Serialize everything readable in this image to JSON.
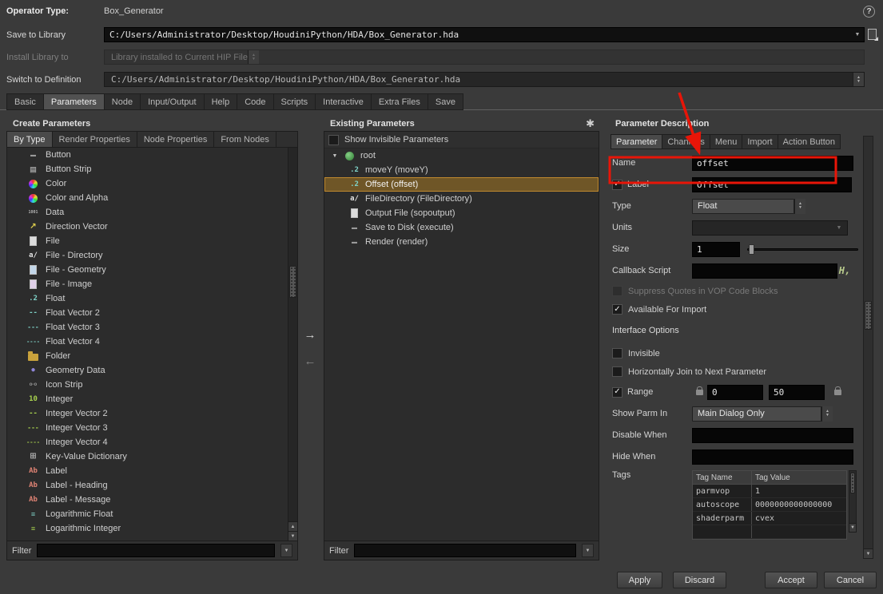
{
  "window": {
    "help_icon": "?"
  },
  "header": {
    "operator_type": {
      "label": "Operator Type:",
      "value": "Box_Generator"
    },
    "save_to_library": {
      "label": "Save to Library",
      "value": "C:/Users/Administrator/Desktop/HoudiniPython/HDA/Box_Generator.hda"
    },
    "install_library_to": {
      "label": "Install Library to",
      "value": "Library installed to Current HIP File"
    },
    "switch_to_definition": {
      "label": "Switch to Definition",
      "value": "C:/Users/Administrator/Desktop/HoudiniPython/HDA/Box_Generator.hda"
    }
  },
  "main_tabs": {
    "items": [
      "Basic",
      "Parameters",
      "Node",
      "Input/Output",
      "Help",
      "Code",
      "Scripts",
      "Interactive",
      "Extra Files",
      "Save"
    ],
    "active": "Parameters"
  },
  "create_parameters": {
    "title": "Create Parameters",
    "tabs": [
      "By Type",
      "Render Properties",
      "Node Properties",
      "From Nodes"
    ],
    "active_tab": "By Type",
    "items": [
      {
        "icon": "button-icon",
        "label": "Button"
      },
      {
        "icon": "button-strip-icon",
        "label": "Button Strip"
      },
      {
        "icon": "color-icon",
        "label": "Color"
      },
      {
        "icon": "color-alpha-icon",
        "label": "Color and Alpha"
      },
      {
        "icon": "data-icon",
        "label": "Data"
      },
      {
        "icon": "direction-vector-icon",
        "label": "Direction Vector"
      },
      {
        "icon": "file-icon",
        "label": "File"
      },
      {
        "icon": "file-directory-icon",
        "label": "File - Directory"
      },
      {
        "icon": "file-geometry-icon",
        "label": "File - Geometry"
      },
      {
        "icon": "file-image-icon",
        "label": "File - Image"
      },
      {
        "icon": "float-icon",
        "label": "Float"
      },
      {
        "icon": "float-vector2-icon",
        "label": "Float Vector 2"
      },
      {
        "icon": "float-vector3-icon",
        "label": "Float Vector 3"
      },
      {
        "icon": "float-vector4-icon",
        "label": "Float Vector 4"
      },
      {
        "icon": "folder-icon",
        "label": "Folder"
      },
      {
        "icon": "geometry-data-icon",
        "label": "Geometry Data"
      },
      {
        "icon": "icon-strip-icon",
        "label": "Icon Strip"
      },
      {
        "icon": "integer-icon",
        "label": "Integer"
      },
      {
        "icon": "integer-vector2-icon",
        "label": "Integer Vector 2"
      },
      {
        "icon": "integer-vector3-icon",
        "label": "Integer Vector 3"
      },
      {
        "icon": "integer-vector4-icon",
        "label": "Integer Vector 4"
      },
      {
        "icon": "key-value-dictionary-icon",
        "label": "Key-Value Dictionary"
      },
      {
        "icon": "label-icon",
        "label": "Label"
      },
      {
        "icon": "label-heading-icon",
        "label": "Label - Heading"
      },
      {
        "icon": "label-message-icon",
        "label": "Label - Message"
      },
      {
        "icon": "log-float-icon",
        "label": "Logarithmic Float"
      },
      {
        "icon": "log-integer-icon",
        "label": "Logarithmic Integer"
      }
    ],
    "filter_label": "Filter",
    "filter_value": ""
  },
  "existing_parameters": {
    "title": "Existing Parameters",
    "show_invisible_label": "Show Invisible Parameters",
    "show_invisible_checked": false,
    "tree": [
      {
        "icon": "root-globe-icon",
        "label": "root",
        "depth": 0,
        "expanded": true
      },
      {
        "icon": "float-icon",
        "label": "moveY (moveY)",
        "depth": 1
      },
      {
        "icon": "float-icon",
        "label": "Offset (offset)",
        "depth": 1,
        "selected": true
      },
      {
        "icon": "file-directory-icon",
        "label": "FileDirectory (FileDirectory)",
        "depth": 1
      },
      {
        "icon": "file-icon",
        "label": "Output File (sopoutput)",
        "depth": 1
      },
      {
        "icon": "button-icon",
        "label": "Save to Disk (execute)",
        "depth": 1
      },
      {
        "icon": "button-icon",
        "label": "Render (render)",
        "depth": 1
      }
    ],
    "filter_label": "Filter",
    "filter_value": ""
  },
  "parameter_description": {
    "title": "Parameter Description",
    "tabs": [
      "Parameter",
      "Channels",
      "Menu",
      "Import",
      "Action Button"
    ],
    "active_tab": "Parameter",
    "fields": {
      "name": {
        "label": "Name",
        "value": "offset"
      },
      "label": {
        "label": "Label",
        "value": "Offset",
        "checked": true
      },
      "type": {
        "label": "Type",
        "value": "Float"
      },
      "units": {
        "label": "Units",
        "value": ""
      },
      "size": {
        "label": "Size",
        "value": "1"
      },
      "callback": {
        "label": "Callback Script",
        "value": ""
      },
      "suppress_quotes": {
        "label": "Suppress Quotes in VOP Code Blocks",
        "checked": false,
        "disabled": true
      },
      "available_for_import": {
        "label": "Available For Import",
        "checked": true
      },
      "interface_options_heading": "Interface Options",
      "invisible": {
        "label": "Invisible",
        "checked": false
      },
      "horizontal_join": {
        "label": "Horizontally Join to Next Parameter",
        "checked": false
      },
      "range": {
        "label": "Range",
        "checked": true,
        "min": "0",
        "max": "50"
      },
      "show_parm_in": {
        "label": "Show Parm In",
        "value": "Main Dialog Only"
      },
      "disable_when": {
        "label": "Disable When",
        "value": ""
      },
      "hide_when": {
        "label": "Hide When",
        "value": ""
      },
      "tags": {
        "label": "Tags",
        "columns": [
          "Tag Name",
          "Tag Value"
        ],
        "rows": [
          {
            "name": "parmvop",
            "value": "1"
          },
          {
            "name": "autoscope",
            "value": "0000000000000000"
          },
          {
            "name": "shaderparm",
            "value": "cvex"
          }
        ]
      }
    }
  },
  "footer": {
    "apply": "Apply",
    "discard": "Discard",
    "accept": "Accept",
    "cancel": "Cancel"
  },
  "colors": {
    "annotation": "#e81508",
    "selection": "#6f5627"
  }
}
